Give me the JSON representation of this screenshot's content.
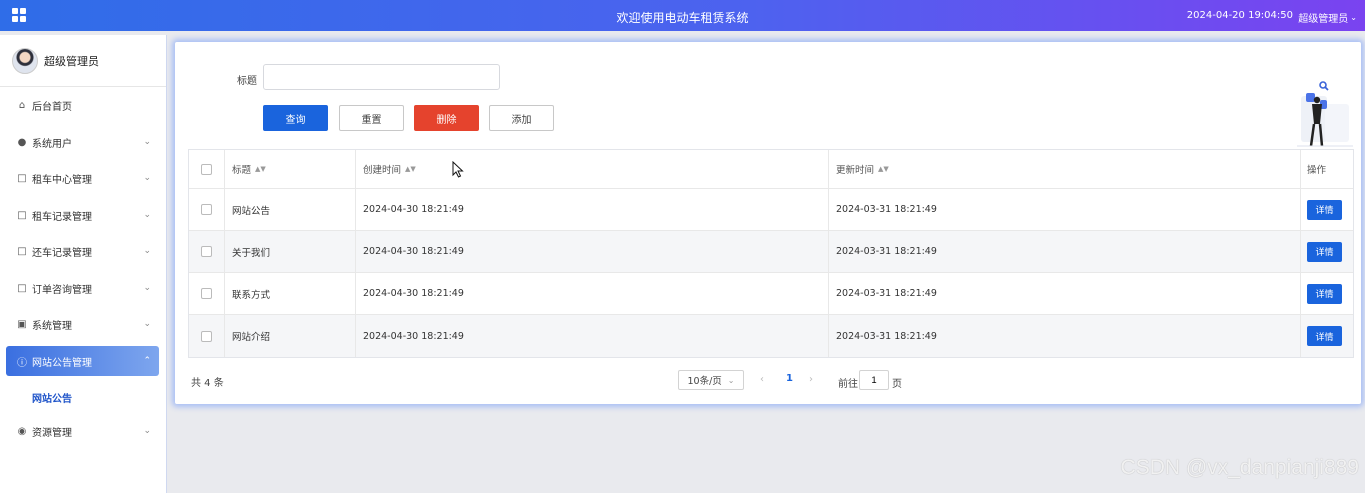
{
  "header": {
    "app_title": "欢迎使用电动车租赁系统",
    "datetime": "2024-04-20 19:04:50",
    "user_menu": "超级管理员"
  },
  "sidebar": {
    "profile_name": "超级管理员",
    "items": [
      {
        "label": "后台首页",
        "icon": "home-icon"
      },
      {
        "label": "系统用户",
        "icon": "user-icon"
      },
      {
        "label": "租车中心管理",
        "icon": "doc-icon"
      },
      {
        "label": "租车记录管理",
        "icon": "doc-icon"
      },
      {
        "label": "还车记录管理",
        "icon": "doc-icon"
      },
      {
        "label": "订单咨询管理",
        "icon": "doc-icon"
      },
      {
        "label": "系统管理",
        "icon": "image-icon"
      },
      {
        "label": "网站公告管理",
        "icon": "info-icon"
      },
      {
        "label": "资源管理",
        "icon": "location-icon"
      }
    ],
    "active_submenu": "网站公告"
  },
  "filter": {
    "title_label": "标题",
    "title_value": "",
    "search_label": "查询",
    "reset_label": "重置",
    "delete_label": "删除",
    "add_label": "添加"
  },
  "table": {
    "headers": {
      "title": "标题",
      "created": "创建时间",
      "updated": "更新时间",
      "op": "操作"
    },
    "rows": [
      {
        "title": "网站公告",
        "created": "2024-04-30 18:21:49",
        "updated": "2024-03-31 18:21:49",
        "action": "详情"
      },
      {
        "title": "关于我们",
        "created": "2024-04-30 18:21:49",
        "updated": "2024-03-31 18:21:49",
        "action": "详情"
      },
      {
        "title": "联系方式",
        "created": "2024-04-30 18:21:49",
        "updated": "2024-03-31 18:21:49",
        "action": "详情"
      },
      {
        "title": "网站介绍",
        "created": "2024-04-30 18:21:49",
        "updated": "2024-03-31 18:21:49",
        "action": "详情"
      }
    ]
  },
  "pagination": {
    "total": "共 4 条",
    "page_size": "10条/页",
    "current_page": "1",
    "goto_label": "前往",
    "goto_value": "1",
    "goto_suffix": "页"
  },
  "watermark": "CSDN @vx_danpianji889",
  "colors": {
    "primary": "#1a64dd",
    "danger": "#e5432d",
    "header_start": "#2f6de8",
    "header_end": "#7a43f0"
  }
}
